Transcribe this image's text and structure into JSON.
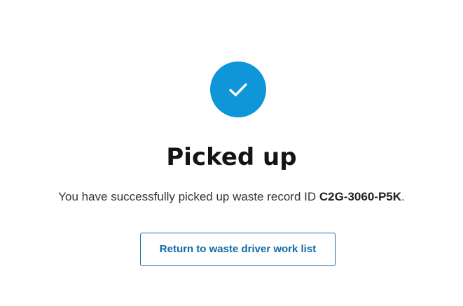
{
  "status": {
    "icon": "checkmark-icon",
    "icon_color": "#0f96d9",
    "title": "Picked up"
  },
  "message": {
    "text_before": "You have successfully picked up waste record ID ",
    "record_id": "C2G-3060-P5K",
    "text_after": "."
  },
  "actions": {
    "return_label": "Return to waste driver work list"
  }
}
